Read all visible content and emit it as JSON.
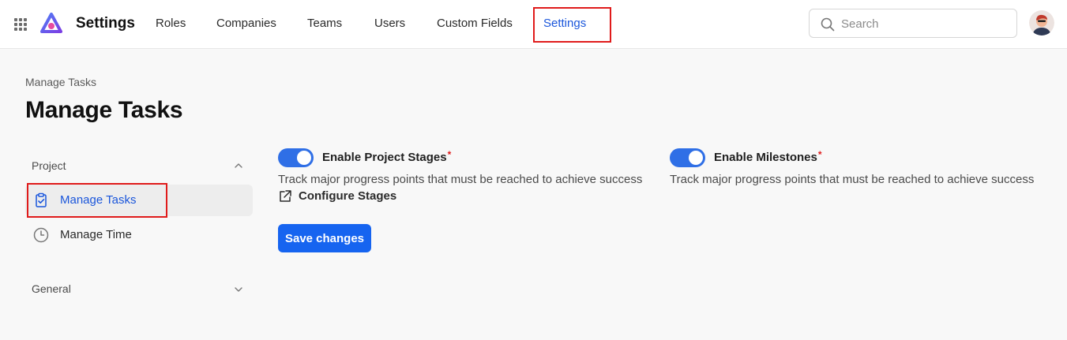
{
  "header": {
    "app_title": "Settings",
    "nav": [
      {
        "label": "Roles"
      },
      {
        "label": "Companies"
      },
      {
        "label": "Teams"
      },
      {
        "label": "Users"
      },
      {
        "label": "Custom Fields"
      },
      {
        "label": "Settings",
        "active": true
      }
    ],
    "search": {
      "placeholder": "Search",
      "icon": "search-icon"
    },
    "icons": {
      "apps": "grid-icon",
      "logo": "app-logo",
      "avatar": "user-avatar"
    },
    "colors": {
      "accent": "#1a56db",
      "highlight": "#e01b1b"
    }
  },
  "page": {
    "breadcrumb": "Manage Tasks",
    "title": "Manage Tasks"
  },
  "sidebar": {
    "sections": [
      {
        "label": "Project",
        "expanded": true,
        "items": [
          {
            "label": "Manage Tasks",
            "icon": "clipboard-check-icon",
            "selected": true
          },
          {
            "label": "Manage Time",
            "icon": "clock-icon",
            "selected": false
          }
        ]
      },
      {
        "label": "General",
        "expanded": false
      }
    ]
  },
  "settings": {
    "project_stages": {
      "label": "Enable Project Stages",
      "required_mark": "*",
      "enabled": true,
      "description": "Track major progress points that must be reached to achieve success",
      "link_label": "Configure Stages",
      "link_icon": "external-link-icon"
    },
    "milestones": {
      "label": "Enable Milestones",
      "required_mark": "*",
      "enabled": true,
      "description": "Track major progress points that must be reached to achieve success"
    },
    "save_label": "Save changes",
    "toggle_color": "#2f6fe6",
    "button_color": "#1664f0"
  }
}
